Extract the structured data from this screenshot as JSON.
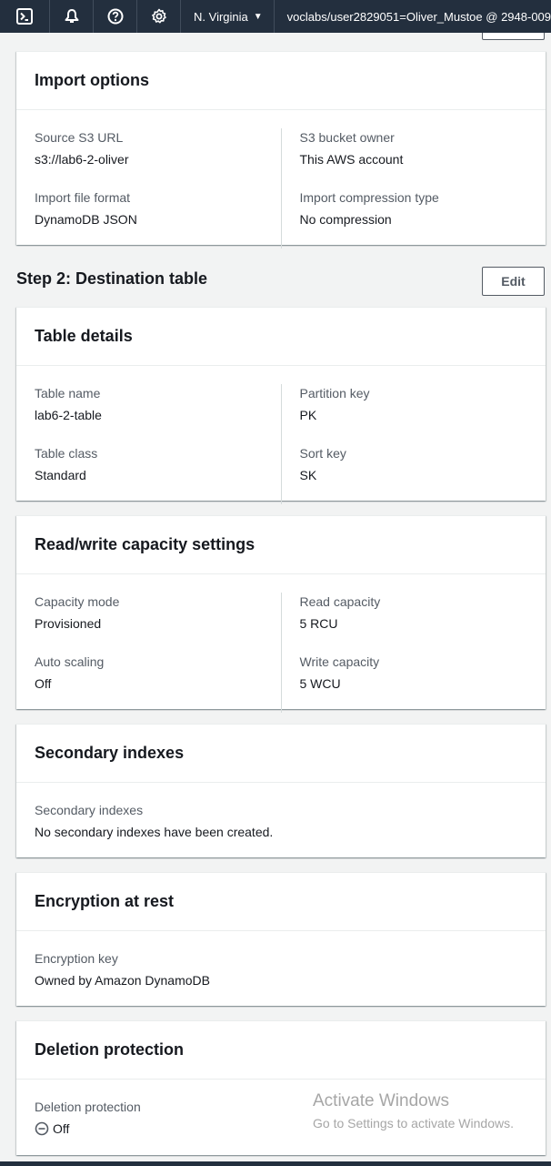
{
  "topbar": {
    "icons": [
      "cloudshell-icon",
      "bell-icon",
      "help-icon",
      "gear-icon"
    ],
    "region": "N. Virginia",
    "account": "voclabs/user2829051=Oliver_Mustoe @ 2948-009"
  },
  "import_options": {
    "title": "Import options",
    "source_s3_url_label": "Source S3 URL",
    "source_s3_url_value": "s3://lab6-2-oliver",
    "bucket_owner_label": "S3 bucket owner",
    "bucket_owner_value": "This AWS account",
    "file_format_label": "Import file format",
    "file_format_value": "DynamoDB JSON",
    "compression_label": "Import compression type",
    "compression_value": "No compression"
  },
  "step2": {
    "title": "Step 2: Destination table",
    "edit_label": "Edit"
  },
  "table_details": {
    "title": "Table details",
    "table_name_label": "Table name",
    "table_name_value": "lab6-2-table",
    "partition_key_label": "Partition key",
    "partition_key_value": "PK",
    "table_class_label": "Table class",
    "table_class_value": "Standard",
    "sort_key_label": "Sort key",
    "sort_key_value": "SK"
  },
  "capacity": {
    "title": "Read/write capacity settings",
    "mode_label": "Capacity mode",
    "mode_value": "Provisioned",
    "read_label": "Read capacity",
    "read_value": "5 RCU",
    "autoscaling_label": "Auto scaling",
    "autoscaling_value": "Off",
    "write_label": "Write capacity",
    "write_value": "5 WCU"
  },
  "secondary_indexes": {
    "title": "Secondary indexes",
    "label": "Secondary indexes",
    "value": "No secondary indexes have been created."
  },
  "encryption": {
    "title": "Encryption at rest",
    "label": "Encryption key",
    "value": "Owned by Amazon DynamoDB"
  },
  "deletion_protection": {
    "title": "Deletion protection",
    "label": "Deletion protection",
    "value": "Off"
  },
  "watermark": {
    "title": "Activate Windows",
    "subtitle": "Go to Settings to activate Windows."
  }
}
